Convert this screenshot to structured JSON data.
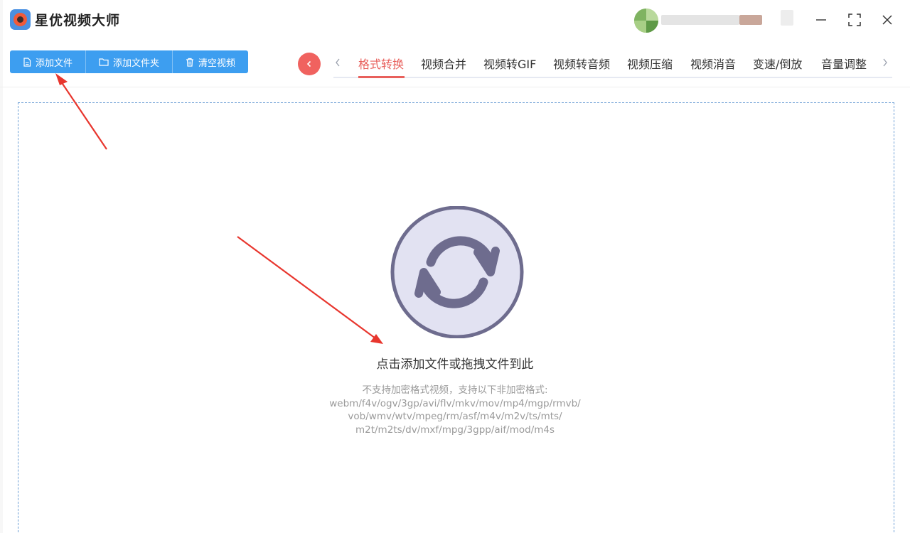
{
  "app": {
    "title": "星优视频大师"
  },
  "toolbar": {
    "buttons": [
      {
        "label": "添加文件",
        "icon": "file-icon"
      },
      {
        "label": "添加文件夹",
        "icon": "folder-icon"
      },
      {
        "label": "清空视频",
        "icon": "trash-icon"
      }
    ]
  },
  "tabs": {
    "items": [
      "格式转换",
      "视频合并",
      "视频转GIF",
      "视频转音频",
      "视频压缩",
      "视频消音",
      "变速/倒放",
      "音量调整"
    ],
    "active": "格式转换"
  },
  "dropzone": {
    "title": "点击添加文件或拖拽文件到此",
    "formats_lines": [
      "不支持加密格式视频，支持以下非加密格式:",
      "webm/f4v/ogv/3gp/avi/flv/mkv/mov/mp4/mgp/rmvb/",
      "vob/wmv/wtv/mpeg/rm/asf/m4v/m2v/ts/mts/",
      "m2t/m2ts/dv/mxf/mpg/3gpp/aif/mod/m4s"
    ]
  },
  "colors": {
    "accent_blue": "#3d9ef0",
    "accent_red": "#e8605c",
    "annotation_arrow": "#e8362e",
    "refresh_circle_fill": "#e2e2f2",
    "refresh_circle_stroke": "#6e6c8e"
  }
}
